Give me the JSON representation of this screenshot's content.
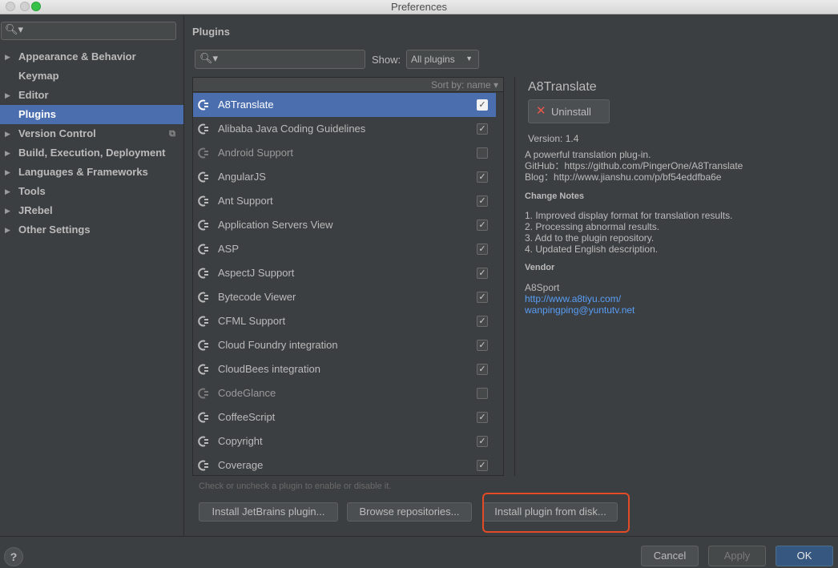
{
  "window": {
    "title": "Preferences"
  },
  "sidebar": {
    "search_icon": "search-icon",
    "items": [
      {
        "label": "Appearance & Behavior",
        "expandable": true
      },
      {
        "label": "Keymap",
        "expandable": false
      },
      {
        "label": "Editor",
        "expandable": true
      },
      {
        "label": "Plugins",
        "expandable": false,
        "selected": true
      },
      {
        "label": "Version Control",
        "expandable": true,
        "project_icon": true
      },
      {
        "label": "Build, Execution, Deployment",
        "expandable": true
      },
      {
        "label": "Languages & Frameworks",
        "expandable": true
      },
      {
        "label": "Tools",
        "expandable": true
      },
      {
        "label": "JRebel",
        "expandable": true
      },
      {
        "label": "Other Settings",
        "expandable": true
      }
    ]
  },
  "main": {
    "section_title": "Plugins",
    "show_label": "Show:",
    "show_value": "All plugins",
    "sort_label": "Sort by: name ▾",
    "plugins": [
      {
        "name": "A8Translate",
        "checked": true,
        "selected": true
      },
      {
        "name": "Alibaba Java Coding Guidelines",
        "checked": true
      },
      {
        "name": "Android Support",
        "checked": false
      },
      {
        "name": "AngularJS",
        "checked": true
      },
      {
        "name": "Ant Support",
        "checked": true
      },
      {
        "name": "Application Servers View",
        "checked": true
      },
      {
        "name": "ASP",
        "checked": true
      },
      {
        "name": "AspectJ Support",
        "checked": true
      },
      {
        "name": "Bytecode Viewer",
        "checked": true
      },
      {
        "name": "CFML Support",
        "checked": true
      },
      {
        "name": "Cloud Foundry integration",
        "checked": true
      },
      {
        "name": "CloudBees integration",
        "checked": true
      },
      {
        "name": "CodeGlance",
        "checked": false
      },
      {
        "name": "CoffeeScript",
        "checked": true
      },
      {
        "name": "Copyright",
        "checked": true
      },
      {
        "name": "Coverage",
        "checked": true
      }
    ],
    "hint": "Check or uncheck a plugin to enable or disable it.",
    "buttons": {
      "install_jetbrains": "Install JetBrains plugin...",
      "browse": "Browse repositories...",
      "install_disk": "Install plugin from disk..."
    }
  },
  "detail": {
    "name": "A8Translate",
    "uninstall_label": "Uninstall",
    "version": "Version: 1.4",
    "description": [
      "A powerful translation plug-in.",
      "GitHub：https://github.com/PingerOne/A8Translate",
      "Blog：http://www.jianshu.com/p/bf54eddfba6e"
    ],
    "change_notes_heading": "Change Notes",
    "change_notes": [
      "1. Improved display format for translation results.",
      "2. Processing abnormal results.",
      "3. Add to the plugin repository.",
      "4. Updated English description."
    ],
    "vendor_heading": "Vendor",
    "vendor_name": "A8Sport",
    "vendor_url": "http://www.a8tiyu.com/",
    "vendor_email": "wanpingping@yuntutv.net"
  },
  "footer": {
    "help": "?",
    "cancel": "Cancel",
    "apply": "Apply",
    "ok": "OK"
  },
  "colors": {
    "selection": "#4b6eaf",
    "highlight_box": "#e24b26",
    "link": "#589df6"
  }
}
